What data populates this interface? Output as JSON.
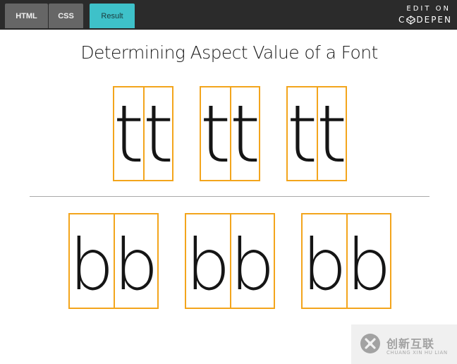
{
  "tabs": [
    {
      "label": "HTML",
      "active": false
    },
    {
      "label": "CSS",
      "active": false
    },
    {
      "label": "Result",
      "active": true
    }
  ],
  "codepen": {
    "edit_on": "EDIT ON",
    "brand_left": "C",
    "brand_right": "DEPEN",
    "icon": "codepen-cube-icon"
  },
  "page": {
    "title": "Determining Aspect Value of a Font"
  },
  "rows": {
    "t_glyph": "t",
    "b_glyph": "b"
  },
  "watermark": {
    "main": "创新互联",
    "sub": "CHUANG XIN HU LIAN",
    "icon": "chuangxin-logo-icon"
  },
  "colors": {
    "topbar": "#2b2b2b",
    "tab_inactive": "#666666",
    "tab_active": "#3ec1c9",
    "box_border": "#f3a51c",
    "divider": "#a9a9a9"
  }
}
